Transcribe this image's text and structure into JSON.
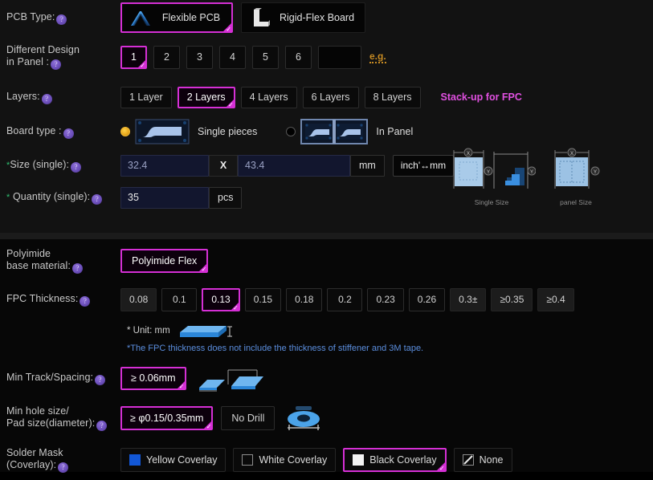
{
  "pcb_type": {
    "label": "PCB Type:",
    "options": [
      {
        "name": "flexible-pcb",
        "label": "Flexible PCB",
        "icon": "flex-arch-icon",
        "selected": true
      },
      {
        "name": "rigid-flex-board",
        "label": "Rigid-Flex Board",
        "icon": "rigid-flex-l-icon",
        "selected": false
      }
    ]
  },
  "different_design": {
    "label_line1": "Different Design",
    "label_line2": "in Panel :",
    "options": [
      "1",
      "2",
      "3",
      "4",
      "5",
      "6"
    ],
    "selected": "1",
    "custom_value": "",
    "custom_placeholder": "",
    "eg_label": "e.g."
  },
  "layers": {
    "label": "Layers:",
    "options": [
      "1 Layer",
      "2 Layers",
      "4 Layers",
      "6 Layers",
      "8 Layers"
    ],
    "selected": "2 Layers",
    "link_label": "Stack-up for FPC"
  },
  "board_type": {
    "label": "Board type :",
    "options": [
      {
        "name": "single-pieces",
        "label": "Single pieces",
        "selected": true
      },
      {
        "name": "in-panel",
        "label": "In Panel",
        "selected": false
      }
    ]
  },
  "size": {
    "label": "Size (single):",
    "required_marker": "*",
    "width_value": "32.4",
    "x_label": "X",
    "length_value": "43.4",
    "unit_label": "mm",
    "convert_label": "inch'↔mm"
  },
  "quantity": {
    "label": "Quantity (single):",
    "required_marker": "*",
    "value": "35",
    "unit_label": "pcs"
  },
  "size_diagrams": [
    {
      "name": "single-size-diagram",
      "caption": "Single Size"
    },
    {
      "name": "panel-size-diagram",
      "caption": "panel Size"
    }
  ],
  "polyimide": {
    "label_line1": "Polyimide",
    "label_line2": "base material:",
    "options": [
      "Polyimide Flex"
    ],
    "selected": "Polyimide Flex"
  },
  "fpc_thickness": {
    "label": "FPC Thickness:",
    "options": [
      "0.08",
      "0.1",
      "0.13",
      "0.15",
      "0.18",
      "0.2",
      "0.23",
      "0.26",
      "0.3±",
      "≥0.35",
      "≥0.4"
    ],
    "disabled": [
      "0.08",
      "0.3±",
      "≥0.35",
      "≥0.4"
    ],
    "selected": "0.13",
    "unit_note": "* Unit: mm",
    "warning_note": "*The FPC thickness does not include the thickness of stiffener and 3M tape."
  },
  "min_track_spacing": {
    "label": "Min Track/Spacing:",
    "options": [
      "≥ 0.06mm"
    ],
    "selected": "≥ 0.06mm"
  },
  "min_hole_size": {
    "label_line1": "Min hole size/",
    "label_line2": "Pad size(diameter):",
    "options": [
      "≥ φ0.15/0.35mm",
      "No Drill"
    ],
    "selected": "≥ φ0.15/0.35mm"
  },
  "solder_mask": {
    "label_line1": "Solder Mask",
    "label_line2": "(Coverlay):",
    "options": [
      {
        "name": "yellow-coverlay",
        "label": "Yellow Coverlay",
        "swatch": "#1257d6",
        "selected": false
      },
      {
        "name": "white-coverlay",
        "label": "White Coverlay",
        "swatch": "#0a0a0a",
        "selected": false
      },
      {
        "name": "black-coverlay",
        "label": "Black Coverlay",
        "swatch": "#f2f2f2",
        "selected": true
      },
      {
        "name": "none-coverlay",
        "label": "None",
        "swatch": "none",
        "selected": false
      }
    ]
  },
  "theme": {
    "accent": "#d52fd5",
    "link": "#e050e0",
    "warn": "#5b8ede",
    "eg": "#c78b23",
    "radio_on": "#e8a81c",
    "required": "#2fbf71"
  }
}
